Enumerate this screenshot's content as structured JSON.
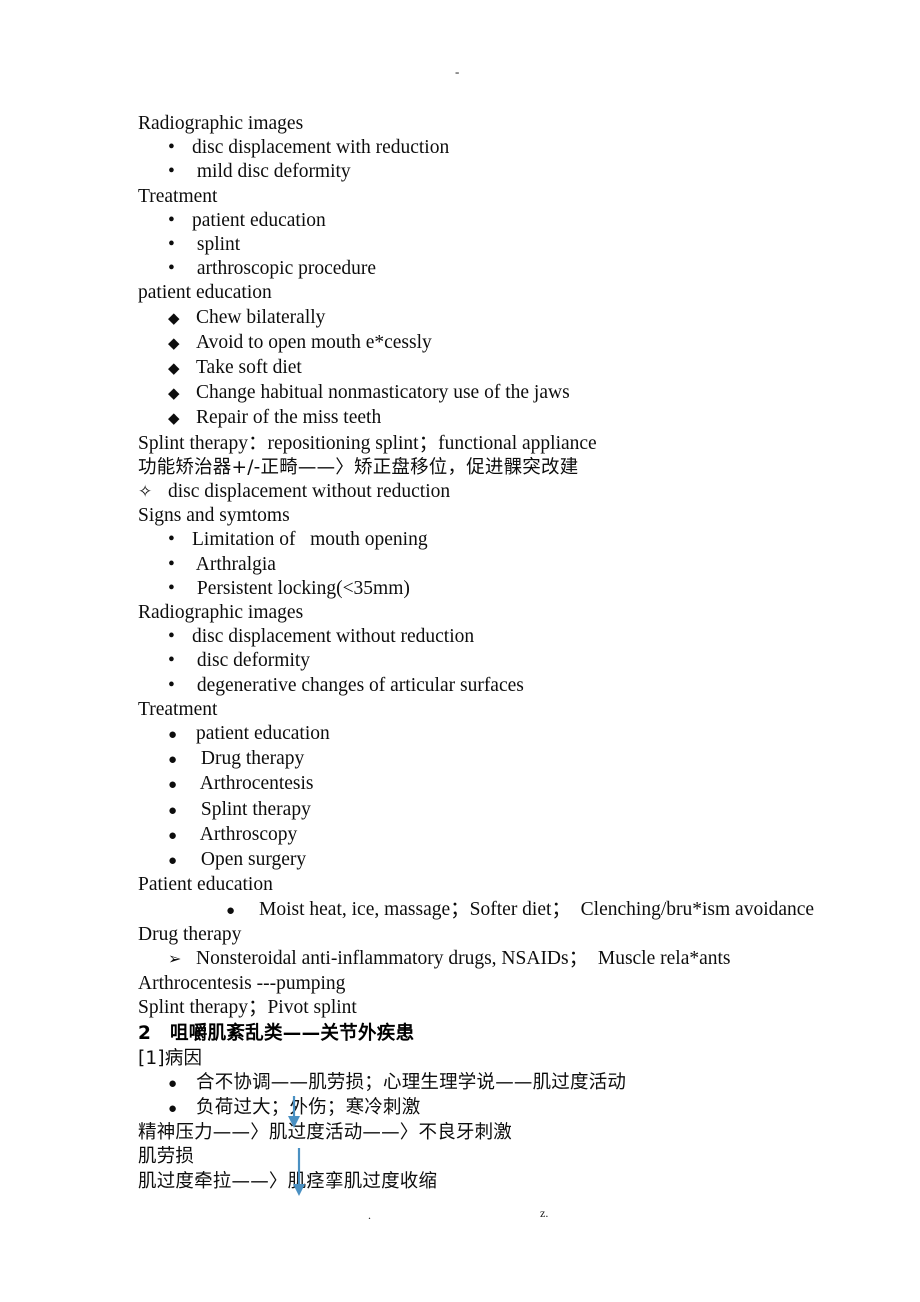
{
  "page": {
    "top_mark": "-",
    "bottom_left_mark": ".",
    "bottom_right_mark": "z.",
    "accent_color": "#4a90c2",
    "text_color": "#0d0d0d",
    "background_color": "#ffffff"
  },
  "markers": {
    "bullet_dot": "•",
    "bullet_diamond": "◆",
    "bullet_disc": "●",
    "bullet_arrow": "➢",
    "bullet_star": "✧"
  },
  "document": {
    "sections": [
      {
        "id": "s1_heading",
        "text": "Radiographic images"
      },
      {
        "id": "s1_i1",
        "text": "disc displacement with reduction"
      },
      {
        "id": "s1_i2",
        "text": " mild disc deformity"
      },
      {
        "id": "s2_heading",
        "text": "Treatment"
      },
      {
        "id": "s2_i1",
        "text": "patient education"
      },
      {
        "id": "s2_i2",
        "text": " splint"
      },
      {
        "id": "s2_i3",
        "text": " arthroscopic procedure"
      },
      {
        "id": "s3_heading",
        "text": "patient education"
      },
      {
        "id": "s3_i1",
        "text": "Chew bilaterally"
      },
      {
        "id": "s3_i2",
        "text": "Avoid to open mouth e*cessly"
      },
      {
        "id": "s3_i3",
        "text": "Take soft diet"
      },
      {
        "id": "s3_i4",
        "text": "Change habitual nonmasticatory use of the jaws"
      },
      {
        "id": "s3_i5",
        "text": "Repair of the miss teeth"
      },
      {
        "id": "s3_splint",
        "text": "Splint therapy：repositioning splint；functional appliance"
      },
      {
        "id": "s3_cjk",
        "text": "功能矫治器+/-正畸——〉矫正盘移位，促进髁突改建"
      },
      {
        "id": "s4_star",
        "text": "disc displacement without reduction"
      },
      {
        "id": "s4_heading",
        "text": "Signs and symtoms"
      },
      {
        "id": "s4_i1",
        "text": "Limitation of   mouth opening"
      },
      {
        "id": "s4_i2",
        "text": " Arthralgia"
      },
      {
        "id": "s4_i3",
        "text": " Persistent locking(<35mm)"
      },
      {
        "id": "s5_heading",
        "text": "Radiographic images"
      },
      {
        "id": "s5_i1",
        "text": "disc displacement without reduction"
      },
      {
        "id": "s5_i2",
        "text": " disc deformity"
      },
      {
        "id": "s5_i3",
        "text": " degenerative changes of articular surfaces"
      },
      {
        "id": "s6_heading",
        "text": "Treatment"
      },
      {
        "id": "s6_i1",
        "text": "patient education"
      },
      {
        "id": "s6_i2",
        "text": " Drug therapy"
      },
      {
        "id": "s6_i3",
        "text": " Arthrocentesis"
      },
      {
        "id": "s6_i4",
        "text": " Splint therapy"
      },
      {
        "id": "s6_i5",
        "text": " Arthroscopy"
      },
      {
        "id": "s6_i6",
        "text": " Open surgery"
      },
      {
        "id": "s7_heading",
        "text": "Patient education"
      },
      {
        "id": "s7_i1",
        "text": "Moist heat, ice, massage；Softer diet；  Clenching/bru*ism avoidance"
      },
      {
        "id": "s8_heading",
        "text": "Drug therapy"
      },
      {
        "id": "s8_i1",
        "text": "Nonsteroidal anti-inflammatory drugs, NSAIDs；  Muscle rela*ants"
      },
      {
        "id": "s9_l1",
        "text": "Arthrocentesis ---pumping"
      },
      {
        "id": "s9_l2",
        "text": "Splint therapy；Pivot splint"
      },
      {
        "id": "s10_heading",
        "text": "2　咀嚼肌紊乱类——关节外疾患"
      },
      {
        "id": "s10_sub",
        "text": "[1]病因"
      },
      {
        "id": "s10_i1",
        "text": "合不协调——肌劳损；心理生理学说——肌过度活动"
      },
      {
        "id": "s10_i2",
        "text": "负荷过大；外伤；寒冷刺激"
      },
      {
        "id": "s10_l1",
        "text": "精神压力——〉肌过度活动——〉不良牙刺激"
      },
      {
        "id": "s10_l2",
        "text": "肌劳损"
      },
      {
        "id": "s10_l3",
        "text": "肌过度牵拉——〉肌痉挛肌过度收缩"
      }
    ]
  }
}
